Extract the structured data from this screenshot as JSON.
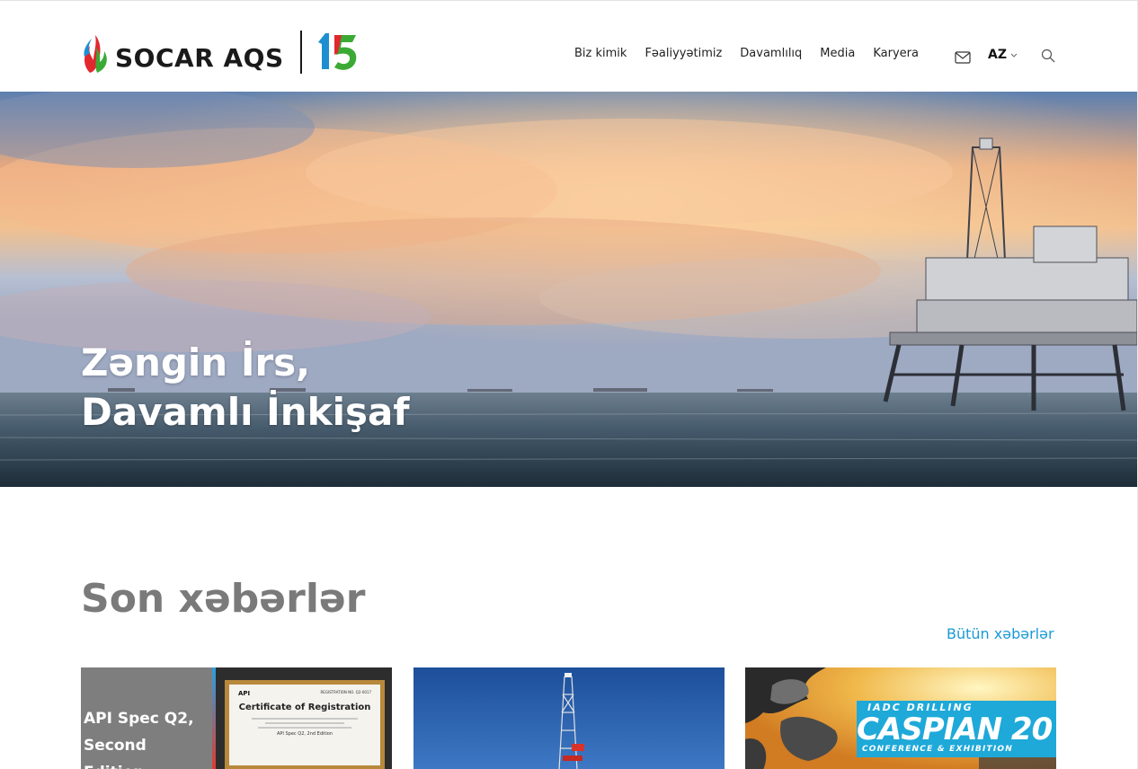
{
  "header": {
    "logo_text": "SOCAR AQS",
    "anniversary_mark": "15",
    "nav": [
      "Biz kimik",
      "Fəaliyyətimiz",
      "Davamlılıq",
      "Media",
      "Karyera"
    ],
    "language": "AZ"
  },
  "hero": {
    "title_line1": "Zəngin İrs,",
    "title_line2": "Davamlı İnkişaf"
  },
  "news": {
    "title": "Son xəbərlər",
    "all_news_label": "Bütün xəbərlər",
    "cards": [
      {
        "caption_line1": "API Spec Q2,",
        "caption_line2": "Second Edition",
        "cert_brand": "API",
        "cert_title": "Certificate of Registration",
        "cert_reg": "REGISTRATION NO. Q2-0017",
        "cert_edition": "API Spec Q2, 2nd Edition"
      },
      {},
      {
        "banner_top": "IADC DRILLING",
        "banner_main": "CASPIAN 20",
        "banner_sub": "CONFERENCE & EXHIBITION"
      }
    ]
  },
  "colors": {
    "link": "#1a9ad6",
    "section_title": "#7a7a7a",
    "caspian_blue": "#1ea9d9"
  },
  "icons": [
    "socar-flame-logo",
    "anniversary-15-logo",
    "mail-icon",
    "chevron-down-icon",
    "search-icon"
  ]
}
